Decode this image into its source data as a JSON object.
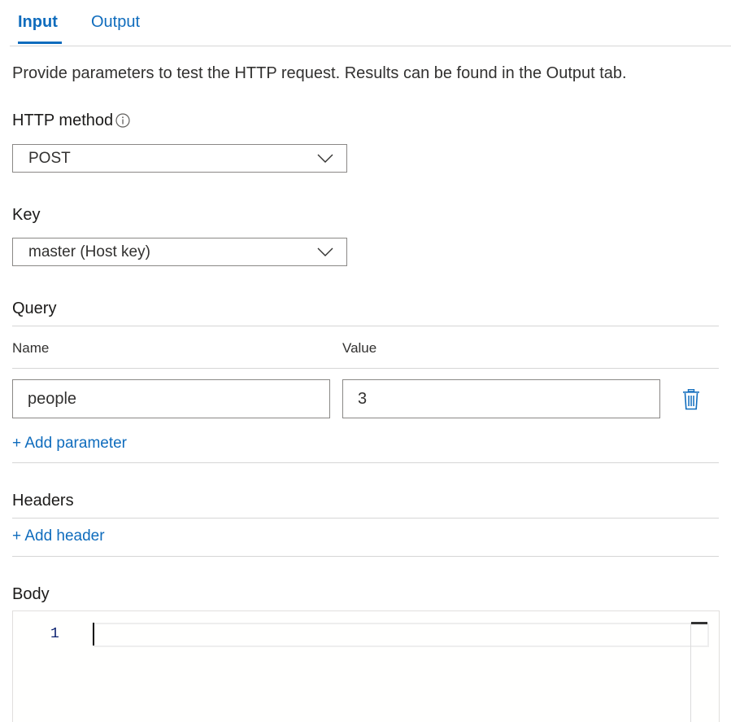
{
  "tabs": [
    {
      "label": "Input",
      "active": true
    },
    {
      "label": "Output",
      "active": false
    }
  ],
  "description": "Provide parameters to test the HTTP request. Results can be found in the Output tab.",
  "http_method": {
    "label": "HTTP method",
    "info_icon": "info-icon",
    "selected": "POST"
  },
  "key": {
    "label": "Key",
    "selected": "master (Host key)"
  },
  "query": {
    "title": "Query",
    "col_name": "Name",
    "col_value": "Value",
    "rows": [
      {
        "name": "people",
        "value": "3"
      }
    ],
    "delete_icon": "trash-icon",
    "add_label": "+ Add parameter"
  },
  "headers": {
    "title": "Headers",
    "add_label": "+ Add header"
  },
  "body": {
    "title": "Body",
    "line_numbers": [
      "1"
    ]
  },
  "colors": {
    "accent": "#0f6cbd",
    "border": "#8a8886",
    "divider": "#d6d6d6",
    "line_number": "#0b216f"
  }
}
